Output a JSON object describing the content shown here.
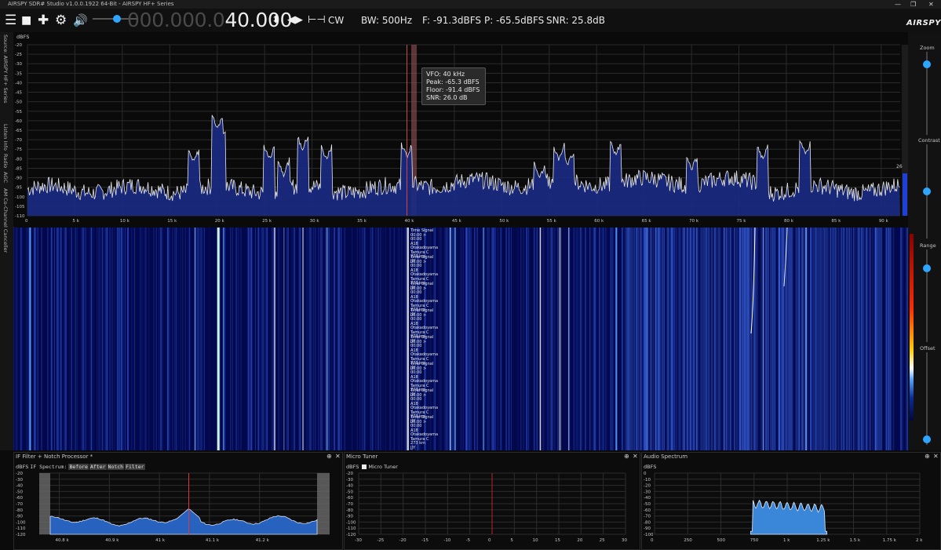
{
  "window": {
    "title": "AIRSPY SDR# Studio v1.0.0.1922 64-Bit - AIRSPY HF+ Series",
    "minimize": "—",
    "maximize": "❐",
    "close": "✕"
  },
  "toolbar": {
    "menu_icon": "menu-icon",
    "stop_icon": "stop-icon",
    "add_icon": "plus-icon",
    "settings_icon": "gear-icon",
    "volume_icon": "speaker-icon",
    "frequency_dim": "000.000.0",
    "frequency_lit": "40.000",
    "mode": "CW",
    "bandwidth": "BW: 500Hz",
    "frequency_level": "F: -91.3dBFS",
    "power": "P: -65.5dBFS",
    "snr": "SNR: 25.8dB",
    "logo": "AIRSPY"
  },
  "left_tabs": [
    "Source: AIRSPY HF+ Series",
    "Listen Info",
    "Radio",
    "AGC",
    "AM Co-Channel Canceller"
  ],
  "spectrum": {
    "y_unit": "dBFS",
    "y_ticks": [
      -20,
      -25,
      -30,
      -35,
      -40,
      -45,
      -50,
      -55,
      -60,
      -65,
      -70,
      -75,
      -80,
      -85,
      -90,
      -95,
      -100,
      -105,
      -110
    ],
    "x_ticks": [
      "0",
      "5 k",
      "10 k",
      "15 k",
      "20 k",
      "25 k",
      "30 k",
      "35 k",
      "40 k",
      "45 k",
      "50 k",
      "55 k",
      "60 k",
      "65 k",
      "70 k",
      "75 k",
      "80 k",
      "85 k",
      "90 k"
    ],
    "right_value": "26",
    "vfo_khz": 40
  },
  "tooltip": {
    "vfo": "VFO:  40 kHz",
    "peak": "Peak: -65.3 dBFS",
    "floor": "Floor: -91.4 dBFS",
    "snr": "SNR:  26.0 dB"
  },
  "right_controls": {
    "zoom": "Zoom",
    "contrast": "Contrast",
    "range": "Range",
    "offset": "Offset",
    "zoom_level": 0.15,
    "contrast_level": 0.5,
    "range_level": 0.2,
    "offset_level": 0.06
  },
  "waterfall": {
    "station_label": [
      "Time Signal",
      "00:00 > 00:00",
      "A18",
      "Otakadoyama Tamura C",
      "273 km",
      "JJY"
    ]
  },
  "if_filter": {
    "title": "IF Filter + Notch Processor *",
    "y_unit": "dBFS",
    "if_spectrum_label": "IF Spectrum:",
    "chips": [
      "Before",
      "After",
      "Notch",
      "Filter"
    ],
    "y_ticks": [
      -20,
      -30,
      -40,
      -50,
      -60,
      -70,
      -80,
      -90,
      -100,
      -110,
      -120
    ],
    "x_ticks": [
      "40.8 k",
      "40.9 k",
      "41 k",
      "41.1 k",
      "41.2 k"
    ]
  },
  "micro_tuner": {
    "title": "Micro Tuner",
    "y_unit": "dBFS",
    "checkbox_label": "Micro Tuner",
    "y_ticks": [
      -20,
      -30,
      -40,
      -50,
      -60,
      -70,
      -80,
      -90,
      -100,
      -110,
      -120
    ],
    "x_ticks": [
      "-30",
      "-25",
      "-20",
      "-15",
      "-10",
      "-5",
      "0",
      "5",
      "10",
      "15",
      "20",
      "25",
      "30"
    ]
  },
  "audio_spectrum": {
    "title": "Audio Spectrum",
    "y_unit": "dBFS",
    "y_ticks": [
      0,
      -10,
      -20,
      -30,
      -40,
      -50,
      -60,
      -70,
      -80,
      -90,
      -100
    ],
    "x_ticks": [
      "0",
      "250",
      "500",
      "750",
      "1 k",
      "1.25 k",
      "1.5 k",
      "1.75 k",
      "2 k"
    ]
  },
  "panel_buttons": {
    "pin": "⊕",
    "close": "✕"
  },
  "colors": {
    "accent": "#2ea6ff",
    "spectrum_fill": "#1c2f86",
    "waterfall_bg": "#03084d",
    "vfo_marker": "#ff4a4a"
  }
}
